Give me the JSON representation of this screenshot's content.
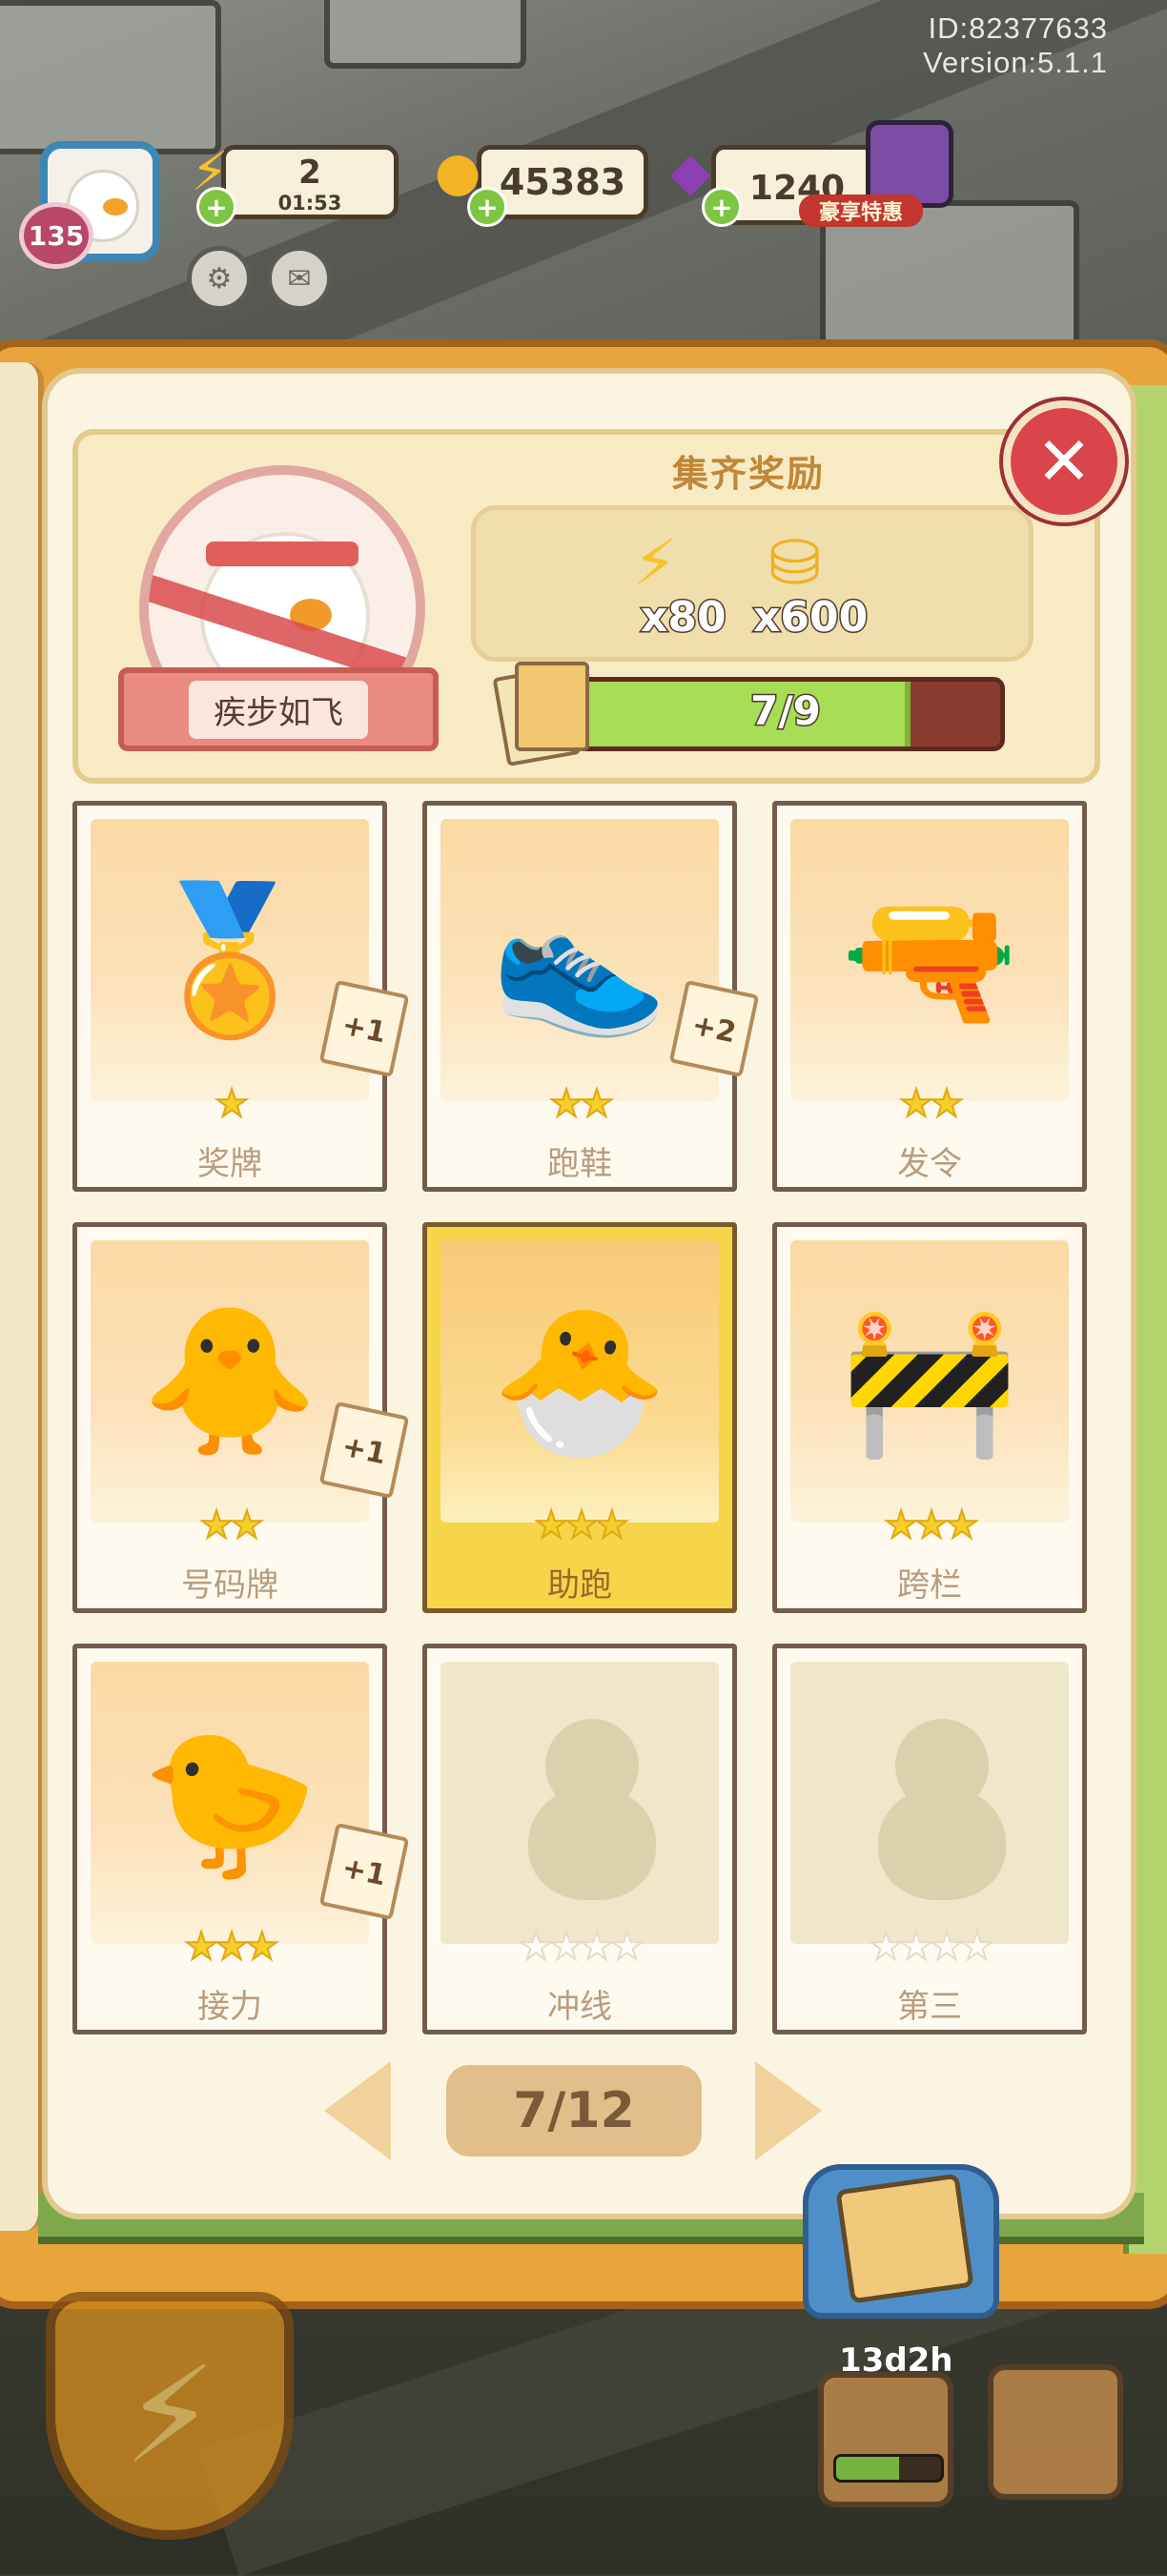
{
  "meta": {
    "id_text": "ID:82377633",
    "version_text": "Version:5.1.1"
  },
  "hud": {
    "level": "135",
    "energy": {
      "value": "2",
      "timer": "01:53",
      "icon": "lightning-icon"
    },
    "coins": {
      "value": "45383",
      "icon": "coin-icon"
    },
    "gems": {
      "value": "1240",
      "icon": "gem-icon"
    },
    "promo_label": "豪享特惠"
  },
  "album": {
    "name": "疾步如飞",
    "reward_title": "集齐奖励",
    "rewards": [
      {
        "icon": "lightning-icon",
        "quantity": "x80"
      },
      {
        "icon": "coin-stack-icon",
        "quantity": "x600"
      }
    ],
    "progress": {
      "text": "7/9",
      "collected": 7,
      "total": 9
    }
  },
  "cards": [
    {
      "label": "奖牌",
      "stars": 1,
      "max_stars": 1,
      "duplicates": "+1",
      "state": "owned",
      "icon": "medal-icon"
    },
    {
      "label": "跑鞋",
      "stars": 2,
      "max_stars": 2,
      "duplicates": "+2",
      "state": "owned",
      "icon": "sneakers-icon"
    },
    {
      "label": "发令",
      "stars": 2,
      "max_stars": 2,
      "duplicates": "",
      "state": "owned",
      "icon": "starting-pistol-icon"
    },
    {
      "label": "号码牌",
      "stars": 2,
      "max_stars": 2,
      "duplicates": "+1",
      "state": "owned",
      "icon": "race-bib-icon"
    },
    {
      "label": "助跑",
      "stars": 3,
      "max_stars": 3,
      "duplicates": "",
      "state": "gold",
      "icon": "crouch-start-icon"
    },
    {
      "label": "跨栏",
      "stars": 3,
      "max_stars": 3,
      "duplicates": "",
      "state": "owned",
      "icon": "hurdles-icon"
    },
    {
      "label": "接力",
      "stars": 3,
      "max_stars": 3,
      "duplicates": "+1",
      "state": "owned",
      "icon": "relay-baton-icon"
    },
    {
      "label": "冲线",
      "stars": 0,
      "max_stars": 4,
      "duplicates": "",
      "state": "locked",
      "icon": "silhouette-icon"
    },
    {
      "label": "第三",
      "stars": 0,
      "max_stars": 4,
      "duplicates": "",
      "state": "locked",
      "icon": "silhouette-icon"
    }
  ],
  "pagination": {
    "text": "7/12"
  },
  "bottom": {
    "event_timer": "13d2h"
  },
  "colors": {
    "accent_gold": "#f5cf2a",
    "progress_green": "#a7dd55",
    "close_red": "#d9454a"
  }
}
